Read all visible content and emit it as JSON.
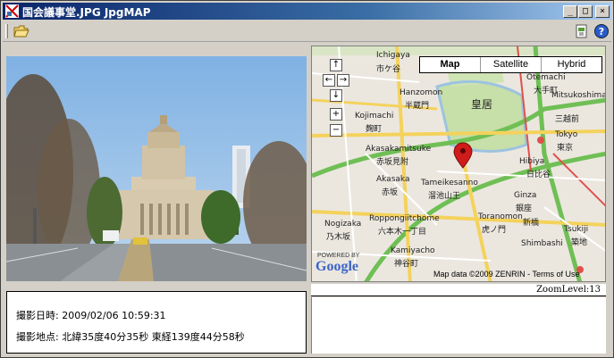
{
  "window": {
    "title": "国会議事堂.JPG JpgMAP",
    "minimize_glyph": "_",
    "maximize_glyph": "□",
    "close_glyph": "×"
  },
  "toolbar": {
    "icons": [
      "open-folder-icon",
      "export-icon",
      "help-icon"
    ]
  },
  "photo": {
    "subject": "National Diet Building photo"
  },
  "info": {
    "datetime_label": "撮影日時:",
    "datetime_value": "2009/02/06 10:59:31",
    "location_label": "撮影地点:",
    "location_value": "北緯35度40分35秒 東経139度44分58秒"
  },
  "map": {
    "type_buttons": [
      "Map",
      "Satellite",
      "Hybrid"
    ],
    "active_type": "Map",
    "nav_up": "↑",
    "nav_left": "←",
    "nav_right": "→",
    "nav_down": "↓",
    "zoom_in": "+",
    "zoom_out": "−",
    "credit": "Map data ©2009 ZENRIN - Terms of Use",
    "logo": "Google",
    "powered": "POWERED BY",
    "labels": {
      "l1": "Ichigaya",
      "l2": "市ケ谷",
      "l3": "Hanzomon",
      "l4": "半蔵門",
      "l5": "皇居",
      "l6": "Kojimachi",
      "l7": "麹町",
      "l8": "Akasakamitsuke",
      "l9": "赤坂見附",
      "l10": "Akasaka",
      "l11": "赤坂",
      "l12": "Tameikesanno",
      "l13": "溜池山王",
      "l14": "Roppongiitchome",
      "l15": "六本木一丁目",
      "l16": "Toranomon",
      "l17": "虎ノ門",
      "l18": "Kamiyacho",
      "l19": "神谷町",
      "l20": "Tokyo",
      "l21": "東京",
      "l22": "Hibiya",
      "l23": "日比谷",
      "l24": "Ginza",
      "l25": "銀座",
      "l26": "Shimbashi",
      "l27": "新橋",
      "l28": "Otemachi",
      "l29": "大手町",
      "l30": "Nogizaka",
      "l31": "乃木坂",
      "l32": "Tsukiji",
      "l33": "築地",
      "l34": "Mitsukoshimae",
      "l35": "三越前"
    },
    "zoom_label": "ZoomLevel:13",
    "colors": {
      "park": "#c7dfa8",
      "road_major": "#f4d25c",
      "road_green": "#6fbf55",
      "road_red": "#e0504b",
      "marker": "#d01b1b"
    }
  }
}
